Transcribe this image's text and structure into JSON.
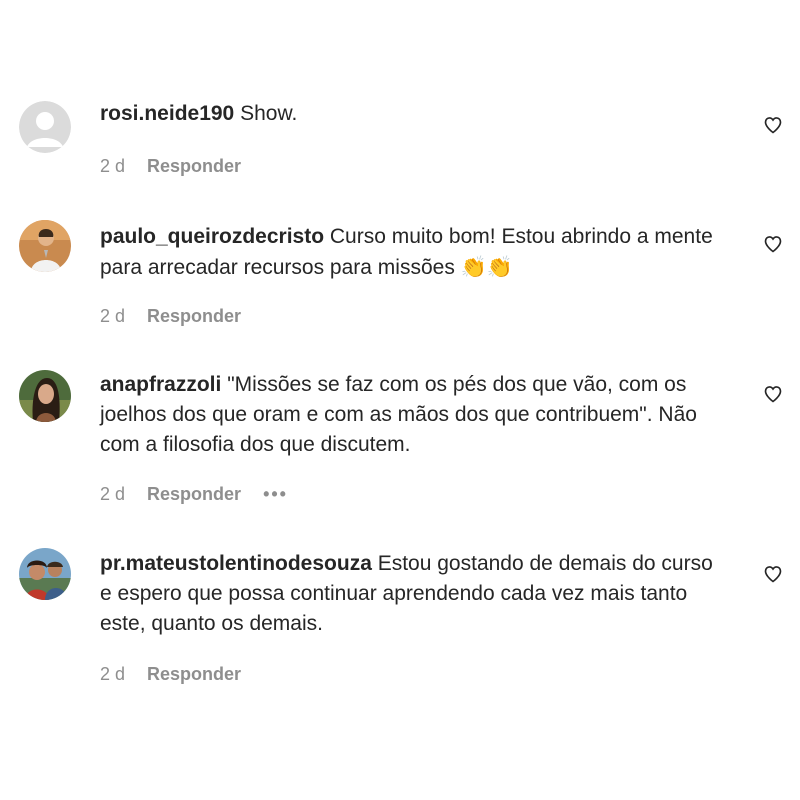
{
  "comments": [
    {
      "username": "rosi.neide190",
      "text": "Show.",
      "time": "2 d",
      "reply_label": "Responder",
      "avatar": "default-avatar-icon",
      "like_icon": "heart-outline-icon"
    },
    {
      "username": "paulo_queirozdecristo",
      "text": "Curso muito bom! Estou abrindo a mente para arrecadar recursos para missões",
      "emoji": "👏👏",
      "time": "2 d",
      "reply_label": "Responder",
      "avatar": "user-photo-avatar",
      "like_icon": "heart-outline-icon"
    },
    {
      "username": "anapfrazzoli",
      "text": "\"Missões se faz com os pés dos que vão, com os joelhos dos que oram e com as mãos dos que contribuem\". Não com a filosofia dos que discutem.",
      "time": "2 d",
      "reply_label": "Responder",
      "more_label": "•••",
      "avatar": "user-photo-avatar",
      "like_icon": "heart-outline-icon"
    },
    {
      "username": "pr.mateustolentinodesouza",
      "text": "Estou gostando de demais do curso e espero que possa continuar aprendendo cada vez mais tanto este, quanto os demais.",
      "time": "2 d",
      "reply_label": "Responder",
      "avatar": "user-photo-avatar",
      "like_icon": "heart-outline-icon"
    }
  ],
  "colors": {
    "text": "#262626",
    "secondary": "#8e8e8e",
    "background": "#ffffff"
  }
}
